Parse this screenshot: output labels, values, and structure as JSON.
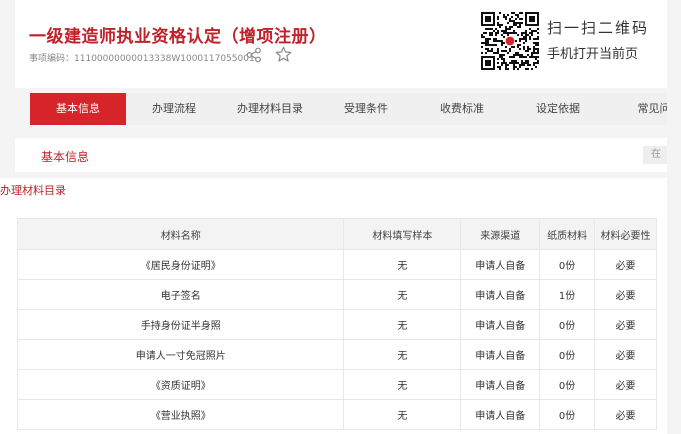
{
  "header": {
    "title": "一级建造师执业资格认定（增项注册）",
    "code_label": "事项编码：",
    "code_value": "11100000000013338W1000117055001",
    "qr_line1": "扫一扫二维码",
    "qr_line2": "手机打开当前页"
  },
  "tabs": [
    {
      "label": "基本信息",
      "active": true
    },
    {
      "label": "办理流程",
      "active": false
    },
    {
      "label": "办理材料目录",
      "active": false
    },
    {
      "label": "受理条件",
      "active": false
    },
    {
      "label": "收费标准",
      "active": false
    },
    {
      "label": "设定依据",
      "active": false
    },
    {
      "label": "常见问",
      "active": false
    }
  ],
  "section": {
    "title": "基本信息",
    "right_fragment": "在"
  },
  "materials": {
    "title": "办理材料目录",
    "columns": [
      "材料名称",
      "材料填写样本",
      "来源渠道",
      "纸质材料",
      "材料必要性"
    ],
    "rows": [
      [
        "《居民身份证明》",
        "无",
        "申请人自备",
        "0份",
        "必要"
      ],
      [
        "电子签名",
        "无",
        "申请人自备",
        "1份",
        "必要"
      ],
      [
        "手持身份证半身照",
        "无",
        "申请人自备",
        "0份",
        "必要"
      ],
      [
        "申请人一寸免冠照片",
        "无",
        "申请人自备",
        "0份",
        "必要"
      ],
      [
        "《资质证明》",
        "无",
        "申请人自备",
        "0份",
        "必要"
      ],
      [
        "《营业执照》",
        "无",
        "申请人自备",
        "0份",
        "必要"
      ]
    ]
  },
  "colors": {
    "brand_red": "#d7242b",
    "title_red": "#c0212b"
  }
}
